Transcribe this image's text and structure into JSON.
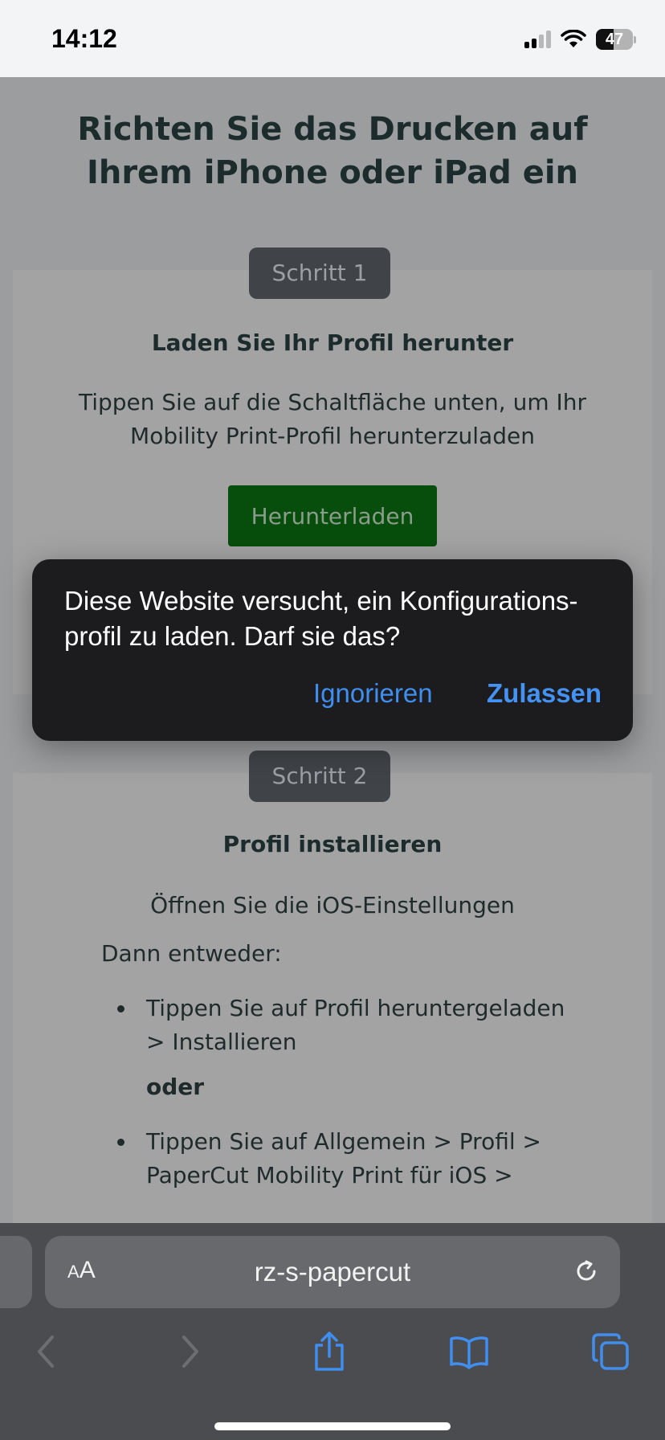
{
  "status_bar": {
    "time": "14:12",
    "battery_level": "47"
  },
  "page": {
    "title": "Richten Sie das Drucken auf Ihrem iPhone oder iPad ein",
    "step1": {
      "badge": "Schritt 1",
      "heading": "Laden Sie Ihr Profil herunter",
      "text": "Tippen Sie auf die Schaltfläche unten, um Ihr Mobility Print-Profil herunterzuladen",
      "button_label": "Herunterladen"
    },
    "step2": {
      "badge": "Schritt 2",
      "heading": "Profil installieren",
      "text": "Öffnen Sie die iOS-Einstellungen",
      "then_label": "Dann entweder:",
      "bullet1": "Tippen Sie auf Profil heruntergeladen > Installieren",
      "or_label": "oder",
      "bullet2": "Tippen Sie auf Allgemein > Profil > PaperCut Mobility Print für iOS >"
    }
  },
  "dialog": {
    "message": "Diese Website versucht, ein Konfigurations-profil zu laden. Darf sie das?",
    "ignore_label": "Ignorieren",
    "allow_label": "Zulassen"
  },
  "toolbar": {
    "aa_small": "A",
    "aa_large": "A",
    "url": "rz-s-papercut",
    "icons": [
      "back-icon",
      "forward-icon",
      "share-icon",
      "bookmarks-icon",
      "tabs-icon",
      "reload-icon"
    ]
  },
  "colors": {
    "accent_blue": "#3f8ef0",
    "download_green": "#074d0b",
    "dialog_bg": "#1c1c1e"
  }
}
